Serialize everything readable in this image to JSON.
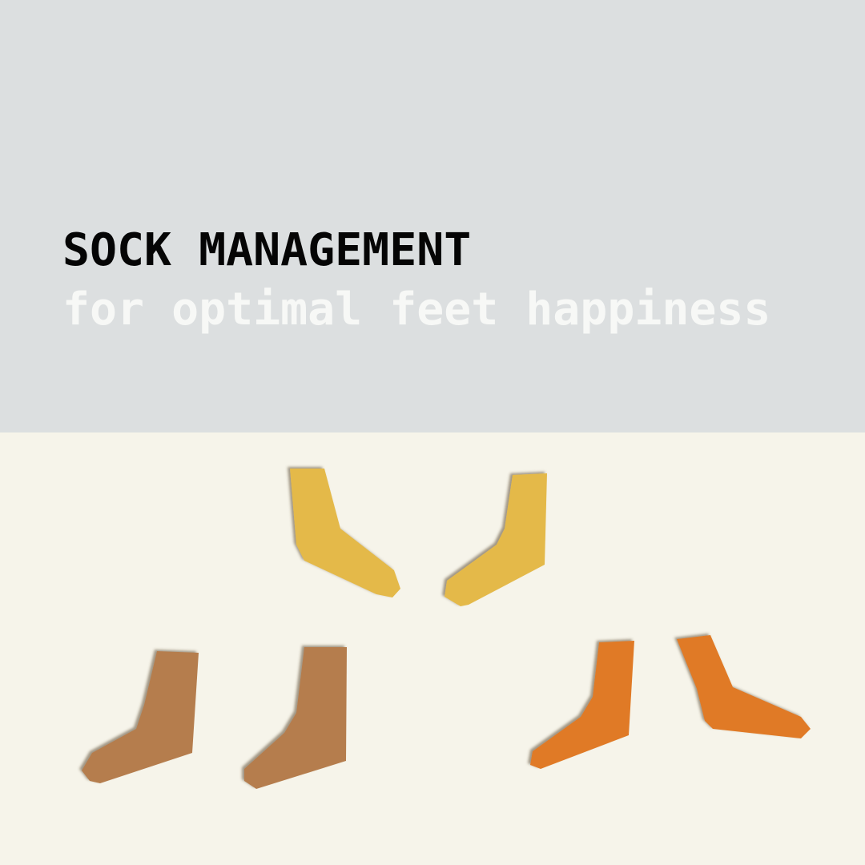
{
  "header": {
    "title": "SOCK MANAGEMENT",
    "subtitle": "for optimal feet happiness"
  },
  "colors": {
    "top_background": "#dcdfe0",
    "bottom_background": "#f6f4ea",
    "yellow_sock": "#e4b94a",
    "brown_sock": "#b57d4e",
    "orange_sock": "#e07a25"
  }
}
